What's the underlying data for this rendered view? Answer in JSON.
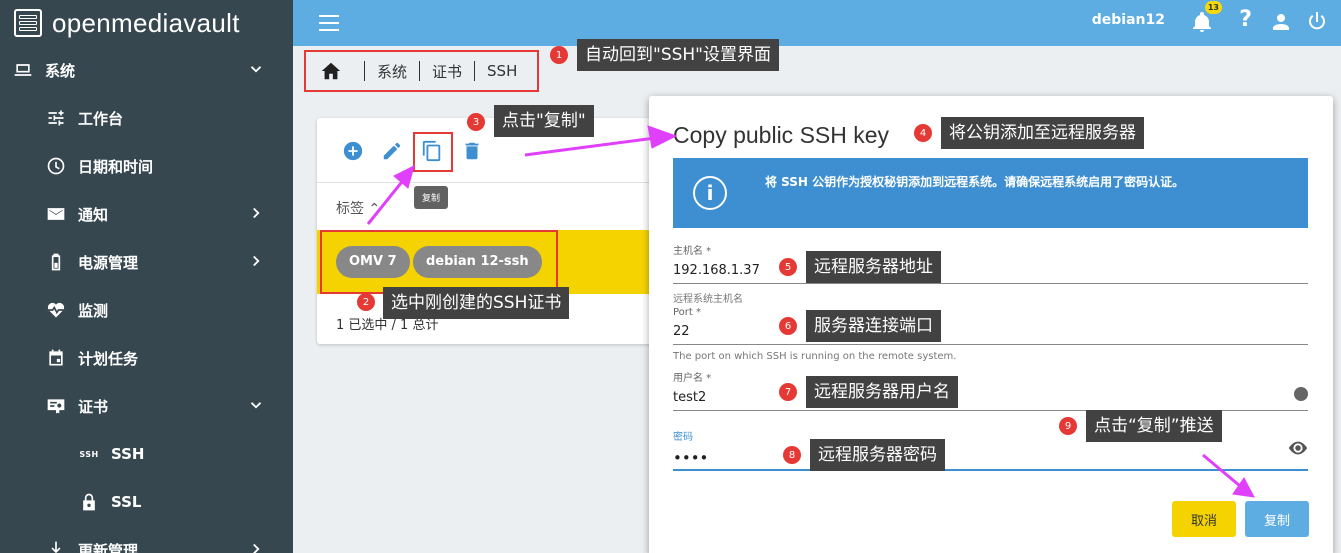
{
  "brand": {
    "name": "openmediavault"
  },
  "sidebar": {
    "items": [
      {
        "label": "系统",
        "icon": "laptop-icon",
        "level": "top",
        "chevron": "down"
      },
      {
        "label": "工作台",
        "icon": "sliders-icon",
        "level": "sub"
      },
      {
        "label": "日期和时间",
        "icon": "clock-icon",
        "level": "sub"
      },
      {
        "label": "通知",
        "icon": "mail-icon",
        "level": "sub",
        "chevron": "right"
      },
      {
        "label": "电源管理",
        "icon": "battery-icon",
        "level": "sub",
        "chevron": "right"
      },
      {
        "label": "监测",
        "icon": "heart-pulse-icon",
        "level": "sub"
      },
      {
        "label": "计划任务",
        "icon": "calendar-icon",
        "level": "sub"
      },
      {
        "label": "证书",
        "icon": "certificate-icon",
        "level": "sub",
        "chevron": "down"
      },
      {
        "label": "SSH",
        "icon": "ssh-icon",
        "level": "subsub",
        "icon_text": "SSH"
      },
      {
        "label": "SSL",
        "icon": "lock-icon",
        "level": "subsub"
      },
      {
        "label": "更新管理",
        "icon": "download-icon",
        "level": "sub",
        "chevron": "right"
      }
    ]
  },
  "topbar": {
    "hostname": "debian12",
    "notification_count": "13",
    "help": "?"
  },
  "breadcrumb": [
    "系统",
    "证书",
    "SSH"
  ],
  "card": {
    "tooltip": "复制",
    "column_header": "标签",
    "chips": [
      "OMV 7",
      "debian 12-ssh"
    ],
    "footer": "1 已选中 / 1 总计"
  },
  "dialog": {
    "title": "Copy public SSH key",
    "info": "将 SSH 公钥作为授权秘钥添加到远程系统。请确保远程系统启用了密码认证。",
    "host": {
      "label": "主机名 *",
      "value": "192.168.1.37",
      "hint": "远程系统主机名"
    },
    "port": {
      "label": "Port *",
      "value": "22",
      "hint": "The port on which SSH is running on the remote system."
    },
    "user": {
      "label": "用户名 *",
      "value": "test2"
    },
    "password": {
      "label": "密码",
      "value": "••••"
    },
    "cancel": "取消",
    "copy": "复制"
  },
  "annotations": [
    {
      "num": "1",
      "text": "自动回到\"SSH\"设置界面"
    },
    {
      "num": "2",
      "text": "选中刚创建的SSH证书"
    },
    {
      "num": "3",
      "text": "点击\"复制\""
    },
    {
      "num": "4",
      "text": "将公钥添加至远程服务器"
    },
    {
      "num": "5",
      "text": "远程服务器地址"
    },
    {
      "num": "6",
      "text": "服务器连接端口"
    },
    {
      "num": "7",
      "text": "远程服务器用户名"
    },
    {
      "num": "8",
      "text": "远程服务器密码"
    },
    {
      "num": "9",
      "text": "点击“复制”推送"
    }
  ],
  "colors": {
    "sidebar": "#37474f",
    "topbar": "#5dade2",
    "accent_yellow": "#f5d300",
    "annotation_red": "#e53935",
    "arrow_magenta": "#e040fb"
  }
}
